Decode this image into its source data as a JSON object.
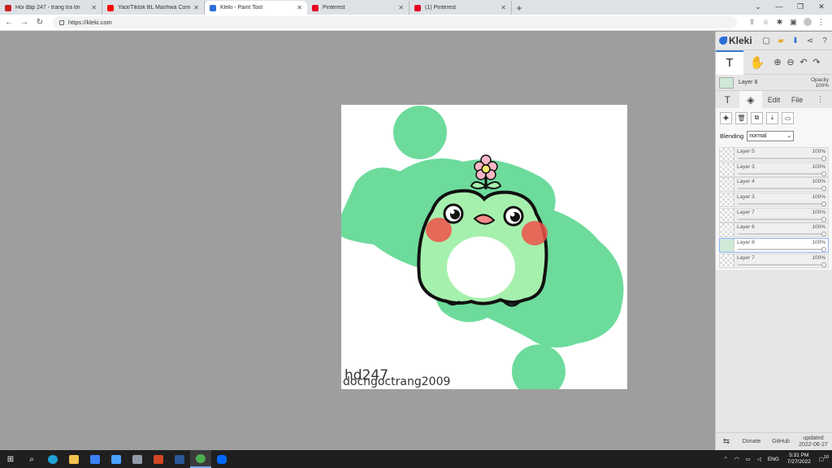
{
  "tabs": [
    {
      "title": "Hỏi đáp 247 - trang tra lời",
      "icon": "gmail-icon",
      "color": "#c5221f",
      "active": false
    },
    {
      "title": "Yaoi/Tiktok BL Manhwa Compilat",
      "icon": "youtube-icon",
      "color": "#ff0000",
      "active": false
    },
    {
      "title": "Kleki - Paint Tool",
      "icon": "kleki-icon",
      "color": "#2b6fd6",
      "active": true
    },
    {
      "title": "Pinterest",
      "icon": "pinterest-icon",
      "color": "#e60023",
      "active": false
    },
    {
      "title": "(1) Pinterest",
      "icon": "pinterest-icon",
      "color": "#e60023",
      "active": false
    }
  ],
  "address": {
    "url": "https://kleki.com"
  },
  "panel": {
    "logo": "Kleki",
    "current_layer": {
      "name": "Layer 8",
      "opacity_label": "Opacity",
      "opacity_value": "100%"
    },
    "tabs": {
      "edit": "Edit",
      "file": "File"
    },
    "blending_label": "Blending",
    "blending_value": "normal",
    "layers": [
      {
        "name": "Layer 5",
        "opacity": "100%",
        "active": false
      },
      {
        "name": "Layer 3",
        "opacity": "100%",
        "active": false
      },
      {
        "name": "Layer 4",
        "opacity": "100%",
        "active": false
      },
      {
        "name": "Layer 3",
        "opacity": "100%",
        "active": false
      },
      {
        "name": "Layer 7",
        "opacity": "100%",
        "active": false
      },
      {
        "name": "Layer 6",
        "opacity": "100%",
        "active": false
      },
      {
        "name": "Layer 8",
        "opacity": "100%",
        "active": true
      },
      {
        "name": "Layer 7",
        "opacity": "100%",
        "active": false
      }
    ],
    "footer": {
      "donate": "Donate",
      "github": "GitHub",
      "updated_label": "updated",
      "updated_date": "2022-06-27"
    }
  },
  "canvas": {
    "watermark_1": "hd247",
    "watermark_2": "docngoctrang2009",
    "colors": {
      "green": "#6ddb9c",
      "frog_light": "#a6f0ad",
      "blush": "#f0514a",
      "outline": "#111111"
    }
  },
  "taskbar": {
    "lang": "ENG",
    "time": "5:31 PM",
    "date": "7/27/2022",
    "notifications": "10"
  }
}
